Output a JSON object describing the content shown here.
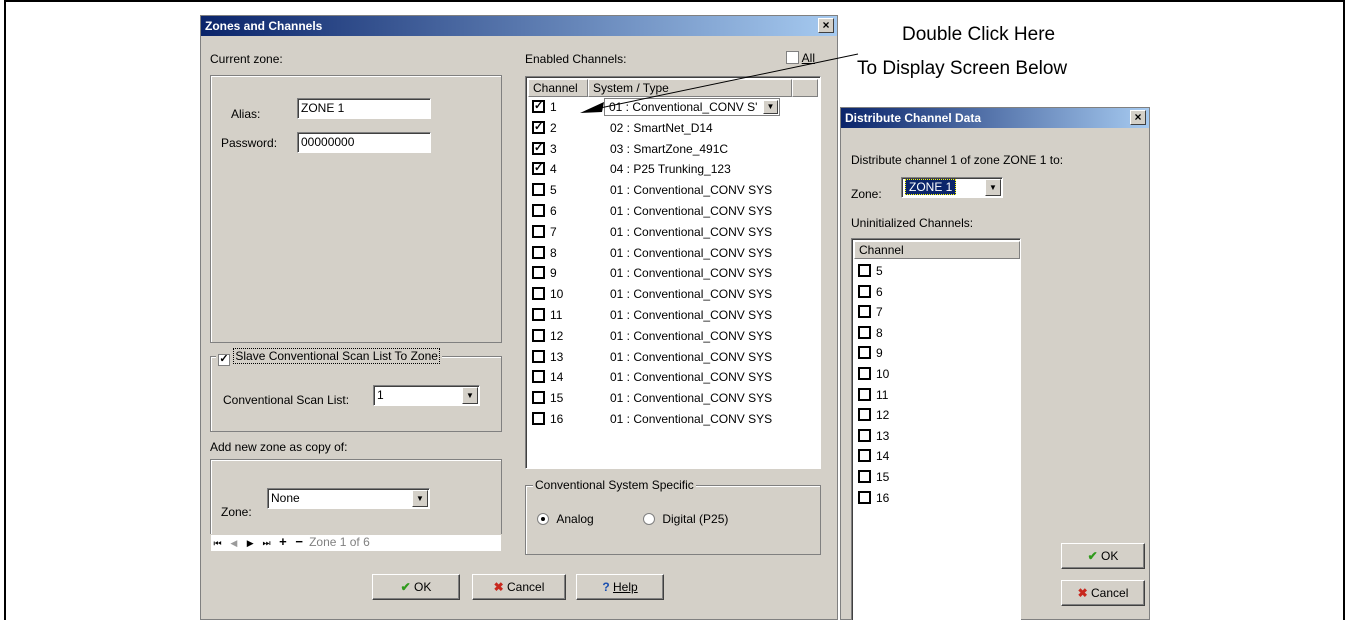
{
  "annotation": {
    "line1": "Double Click Here",
    "line2": "To Display Screen Below"
  },
  "zones_window": {
    "title": "Zones and Channels",
    "close": "×",
    "current_zone_label": "Current zone:",
    "alias_label": "Alias:",
    "alias_value": "ZONE 1",
    "password_label": "Password:",
    "password_value": "00000000",
    "slave_label": "Slave Conventional  Scan List To Zone",
    "scan_list_label": "Conventional Scan List:",
    "scan_list_value": "1",
    "add_zone_label": "Add new zone as copy of:",
    "zone_label": "Zone:",
    "zone_value": "None",
    "nav_status": "Zone 1 of 6",
    "enabled_channels_label": "Enabled Channels:",
    "all_label": "All",
    "col_channel": "Channel",
    "col_system": "System / Type",
    "channels": [
      {
        "num": "1",
        "sys": "01 : Conventional_CONV S'",
        "checked": true
      },
      {
        "num": "2",
        "sys": "02 : SmartNet_D14",
        "checked": true
      },
      {
        "num": "3",
        "sys": "03 : SmartZone_491C",
        "checked": true
      },
      {
        "num": "4",
        "sys": "04 : P25 Trunking_123",
        "checked": true
      },
      {
        "num": "5",
        "sys": "01 : Conventional_CONV SYS",
        "checked": false
      },
      {
        "num": "6",
        "sys": "01 : Conventional_CONV SYS",
        "checked": false
      },
      {
        "num": "7",
        "sys": "01 : Conventional_CONV SYS",
        "checked": false
      },
      {
        "num": "8",
        "sys": "01 : Conventional_CONV SYS",
        "checked": false
      },
      {
        "num": "9",
        "sys": "01 : Conventional_CONV SYS",
        "checked": false
      },
      {
        "num": "10",
        "sys": "01 : Conventional_CONV SYS",
        "checked": false
      },
      {
        "num": "11",
        "sys": "01 : Conventional_CONV SYS",
        "checked": false
      },
      {
        "num": "12",
        "sys": "01 : Conventional_CONV SYS",
        "checked": false
      },
      {
        "num": "13",
        "sys": "01 : Conventional_CONV SYS",
        "checked": false
      },
      {
        "num": "14",
        "sys": "01 : Conventional_CONV SYS",
        "checked": false
      },
      {
        "num": "15",
        "sys": "01 : Conventional_CONV SYS",
        "checked": false
      },
      {
        "num": "16",
        "sys": "01 : Conventional_CONV SYS",
        "checked": false
      }
    ],
    "conv_specific_label": "Conventional System Specific",
    "analog_label": "Analog",
    "digital_label": "Digital (P25)",
    "ok_label": "OK",
    "cancel_label": "Cancel",
    "help_label": "Help"
  },
  "distribute_window": {
    "title": "Distribute Channel Data",
    "close": "×",
    "description": "Distribute channel 1 of zone ZONE 1 to:",
    "zone_label": "Zone:",
    "zone_value": "ZONE 1",
    "uninit_label": "Uninitialized Channels:",
    "col_channel": "Channel",
    "channels": [
      "5",
      "6",
      "7",
      "8",
      "9",
      "10",
      "11",
      "12",
      "13",
      "14",
      "15",
      "16"
    ],
    "ok_label": "OK",
    "cancel_label": "Cancel"
  }
}
